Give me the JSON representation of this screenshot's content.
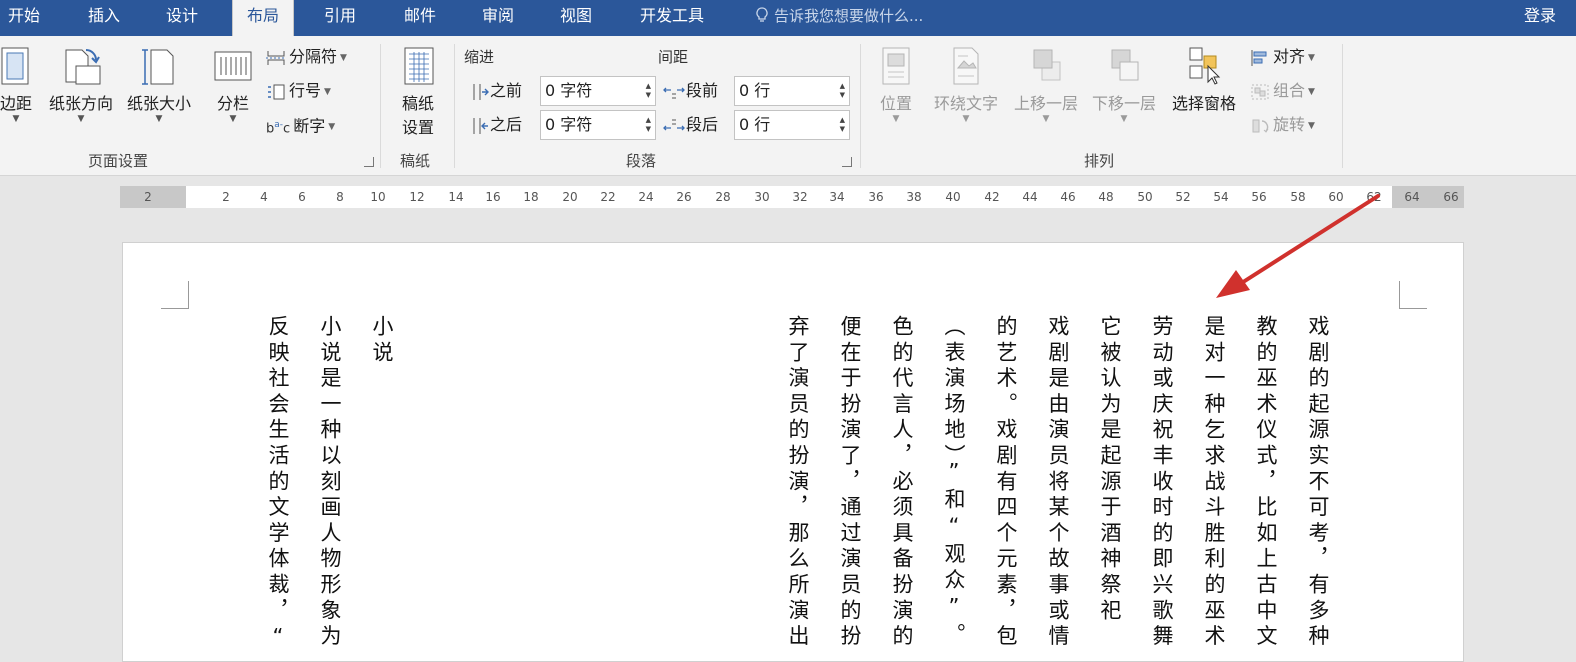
{
  "tabs": [
    "开始",
    "插入",
    "设计",
    "布局",
    "引用",
    "邮件",
    "审阅",
    "视图",
    "开发工具"
  ],
  "active_tab": "布局",
  "tell_me": "告诉我您想要做什么...",
  "login": "登录",
  "page_setup": {
    "margins": "边距",
    "orientation": "纸张方向",
    "size": "纸张大小",
    "columns": "分栏",
    "breaks": "分隔符",
    "line_numbers": "行号",
    "hyphenation": "断字",
    "group_label": "页面设置"
  },
  "draft": {
    "button": "稿纸\n设置",
    "btn_line1": "稿纸",
    "btn_line2": "设置",
    "group_label": "稿纸"
  },
  "paragraph": {
    "indent_header": "缩进",
    "spacing_header": "间距",
    "before_label": "之前",
    "after_label": "之后",
    "before_value": "0 字符",
    "after_value": "0 字符",
    "space_before_label": "段前",
    "space_after_label": "段后",
    "space_before_value": "0 行",
    "space_after_value": "0 行",
    "group_label": "段落"
  },
  "arrange": {
    "position": "位置",
    "wrap_text": "环绕文字",
    "bring_forward": "上移一层",
    "send_backward": "下移一层",
    "selection_pane": "选择窗格",
    "align": "对齐",
    "group": "组合",
    "rotate": "旋转",
    "group_label": "排列"
  },
  "ruler_ticks": [
    "2",
    "2",
    "4",
    "6",
    "8",
    "10",
    "12",
    "14",
    "16",
    "18",
    "20",
    "22",
    "24",
    "26",
    "28",
    "30",
    "32",
    "34",
    "36",
    "38",
    "40",
    "42",
    "44",
    "46",
    "48",
    "50",
    "52",
    "54",
    "56",
    "58",
    "60",
    "62",
    "64",
    "66"
  ],
  "document_columns": [
    "戏剧的起源实不可考，有多种",
    "教的巫术仪式，比如上古中文",
    "是对一种乞求战斗胜利的巫术",
    "劳动或庆祝丰收时的即兴歌舞",
    "它被认为是起源于酒神祭祀",
    "戏剧是由演员将某个故事或情",
    "的艺术。戏剧有四个元素，包",
    "（表演场地）”和“观众”。",
    "色的代言人，必须具备扮演的",
    "便在于扮演了，通过演员的扮",
    "弃了演员的扮演，那么所演出",
    "小说",
    "小说是一种以刻画人物形象为",
    "反映社会生活的文学体裁，“"
  ],
  "colors": {
    "ribbon_blue": "#2b579a",
    "arrow_red": "#d0312d"
  }
}
